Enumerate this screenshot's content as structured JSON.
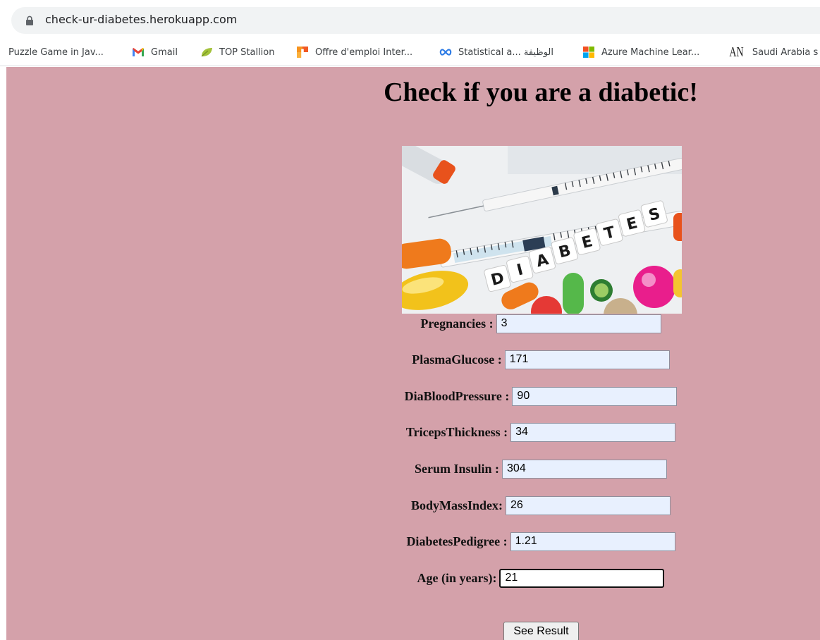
{
  "browser": {
    "url": "check-ur-diabetes.herokuapp.com",
    "bookmarks": [
      {
        "label": "Puzzle Game in Jav...",
        "icon": "none"
      },
      {
        "label": "Gmail",
        "icon": "gmail-icon"
      },
      {
        "label": "TOP Stallion",
        "icon": "leaf-icon"
      },
      {
        "label": "Offre d'emploi Inter...",
        "icon": "flag-icon"
      },
      {
        "label": "Statistical a... الوظيفة",
        "icon": "infinity-icon"
      },
      {
        "label": "Azure Machine Lear...",
        "icon": "microsoft-icon"
      },
      {
        "label": "Saudi Arabia s",
        "icon": "an-logo-icon"
      }
    ]
  },
  "page": {
    "title": "Check if you are a diabetic!",
    "background_color": "#d4a1aa",
    "hero_image_text": "DIABETES",
    "form": {
      "fields": [
        {
          "label": "Pregnancies :",
          "value": "3"
        },
        {
          "label": "PlasmaGlucose :",
          "value": "171"
        },
        {
          "label": "DiaBloodPressure :",
          "value": "90"
        },
        {
          "label": "TricepsThickness :",
          "value": "34"
        },
        {
          "label": "Serum Insulin :",
          "value": "304"
        },
        {
          "label": "BodyMassIndex:",
          "value": "26"
        },
        {
          "label": "DiabetesPedigree :",
          "value": "1.21"
        },
        {
          "label": "Age (in years):",
          "value": "21"
        }
      ],
      "submit_label": "See Result"
    }
  }
}
